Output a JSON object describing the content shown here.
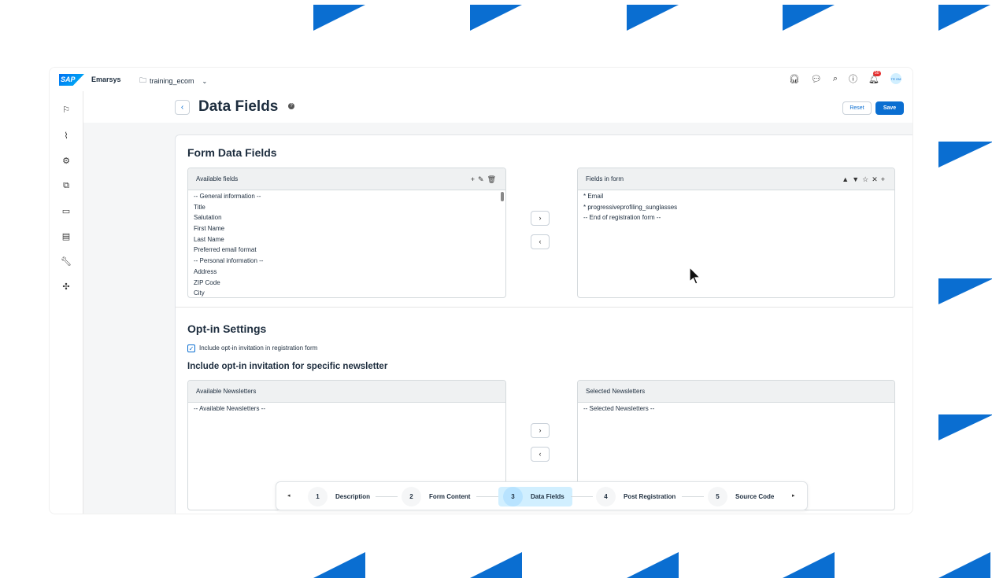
{
  "shell": {
    "logo": "SAP",
    "brand": "Emarsys",
    "space": "training_ecom",
    "notification_count": "50",
    "avatar_initials": "TR GM"
  },
  "header": {
    "back": "‹",
    "title": "Data Fields",
    "reset_label": "Reset",
    "save_label": "Save"
  },
  "form_data_fields": {
    "title": "Form Data Fields",
    "available": {
      "label": "Available fields",
      "tools": [
        "+",
        "✎",
        "🗑"
      ],
      "items": [
        "-- General information --",
        "Title",
        "Salutation",
        "First Name",
        "Last Name",
        "Preferred email format",
        "-- Personal information --",
        "Address",
        "ZIP Code",
        "City"
      ]
    },
    "in_form": {
      "label": "Fields in form",
      "tools": [
        "▲",
        "▼",
        "☆",
        "✕",
        "+"
      ],
      "items": [
        "* Email",
        "* progressiveprofiling_sunglasses",
        "-- End of registration form --"
      ]
    },
    "move_right": "›",
    "move_left": "‹"
  },
  "optin": {
    "title": "Opt-in Settings",
    "checkbox_label": "Include opt-in invitation in registration form",
    "checkbox_checked": true,
    "newsletter_title": "Include opt-in invitation for specific newsletter",
    "available": {
      "label": "Available Newsletters",
      "items": [
        "-- Available Newsletters --"
      ]
    },
    "selected": {
      "label": "Selected Newsletters",
      "items": [
        "-- Selected Newsletters --"
      ]
    }
  },
  "stepper": {
    "prev": "◂",
    "next": "▸",
    "steps": [
      {
        "num": "1",
        "label": "Description"
      },
      {
        "num": "2",
        "label": "Form Content"
      },
      {
        "num": "3",
        "label": "Data Fields"
      },
      {
        "num": "4",
        "label": "Post Registration"
      },
      {
        "num": "5",
        "label": "Source Code"
      }
    ],
    "active_step": 3
  },
  "colors": {
    "accent": "#0a6ed1",
    "active_step_bg": "#d1efff"
  }
}
